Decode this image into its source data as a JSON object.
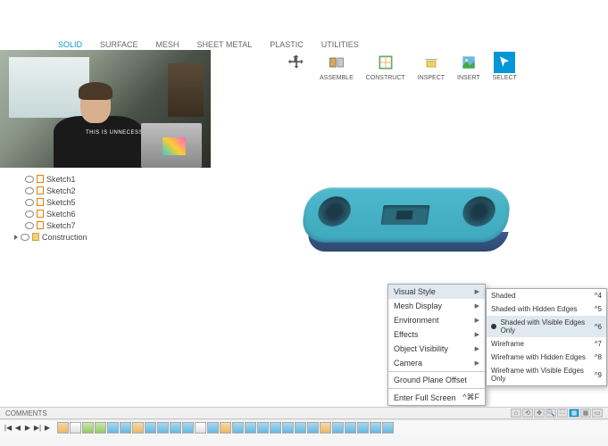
{
  "tabs": {
    "solid": "SOLID",
    "surface": "SURFACE",
    "mesh": "MESH",
    "sheet": "SHEET METAL",
    "plastic": "PLASTIC",
    "utilities": "UTILITIES"
  },
  "ribbon": {
    "assemble": "ASSEMBLE",
    "construct": "CONSTRUCT",
    "inspect": "INSPECT",
    "insert": "INSERT",
    "select": "SELECT"
  },
  "webcam_text": "THIS IS UNNECESSA",
  "browser": {
    "items": [
      {
        "label": "Sketch1"
      },
      {
        "label": "Sketch2"
      },
      {
        "label": "Sketch5"
      },
      {
        "label": "Sketch6"
      },
      {
        "label": "Sketch7"
      }
    ],
    "construction": "Construction"
  },
  "context": {
    "visual_style": "Visual Style",
    "mesh": "Mesh Display",
    "env": "Environment",
    "effects": "Effects",
    "objvis": "Object Visibility",
    "camera": "Camera",
    "gpo": "Ground Plane Offset",
    "fullscreen": "Enter Full Screen",
    "fullscreen_key": "^⌘F"
  },
  "submenu": {
    "shaded": "Shaded",
    "shaded_key": "^4",
    "hidden": "Shaded with Hidden Edges",
    "hidden_key": "^5",
    "visible": "Shaded with Visible Edges Only",
    "visible_key": "^6",
    "wire": "Wireframe",
    "wire_key": "^7",
    "wire_h": "Wireframe with Hidden Edges",
    "wire_h_key": "^8",
    "wire_v": "Wireframe with Visible Edges Only",
    "wire_v_key": "^9"
  },
  "comments_label": "COMMENTS"
}
